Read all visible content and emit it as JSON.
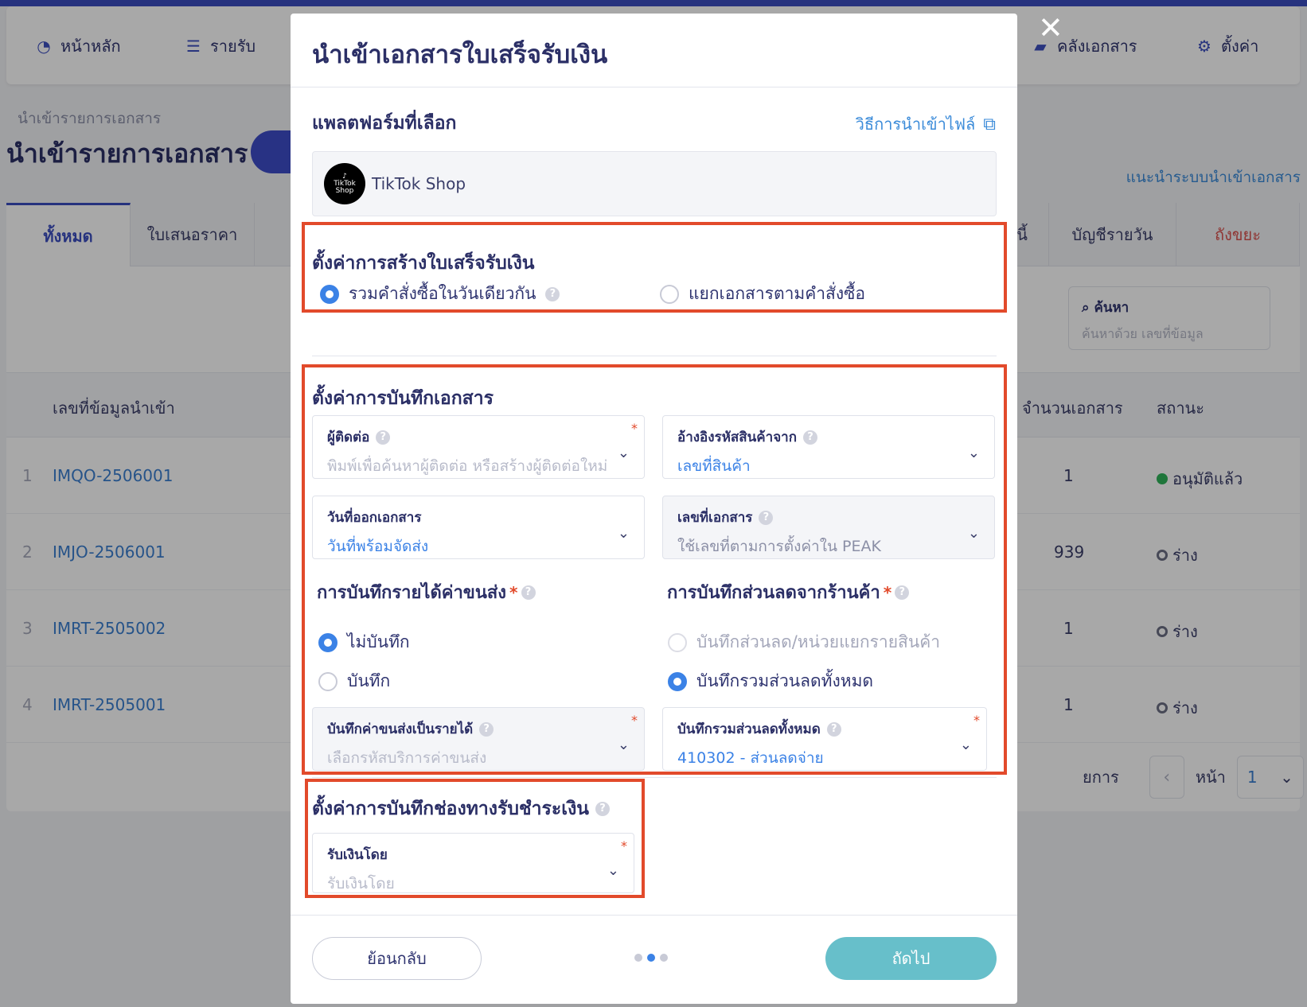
{
  "nav": {
    "items": [
      {
        "icon": "dashboard-icon",
        "label": "หน้าหลัก"
      },
      {
        "icon": "coins-icon",
        "label": "รายรับ"
      },
      {
        "icon": "folder-icon",
        "label": "คลังเอกสาร"
      },
      {
        "icon": "gear-icon",
        "label": "ตั้งค่า"
      }
    ]
  },
  "page": {
    "breadcrumb": "นำเข้ารายการเอกสาร",
    "title": "นำเข้ารายการเอกสาร",
    "guide_link": "แนะนำระบบนำเข้าเอกสาร",
    "tabs": [
      "ทั้งหมด",
      "ใบเสนอราคา",
      "หนี้",
      "บัญชีรายวัน",
      "ถังขยะ"
    ],
    "search": {
      "label": "ค้นหา",
      "placeholder": "ค้นหาด้วย เลขที่ข้อมูล"
    },
    "table": {
      "headers": [
        "เลขที่ข้อมูลนำเข้า",
        "จำนวนเอกสาร",
        "สถานะ"
      ],
      "rows": [
        {
          "index": "1",
          "id": "IMQO-2506001",
          "count": "1",
          "status": "อนุมัติแล้ว"
        },
        {
          "index": "2",
          "id": "IMJO-2506001",
          "count": "939",
          "status": "ร่าง"
        },
        {
          "index": "3",
          "id": "IMRT-2505002",
          "count": "1",
          "status": "ร่าง"
        },
        {
          "index": "4",
          "id": "IMRT-2505001",
          "count": "1",
          "status": "ร่าง"
        }
      ]
    },
    "pager": {
      "items_suffix": "ยการ",
      "page_label": "หน้า",
      "page_value": "1"
    }
  },
  "modal": {
    "title": "นำเข้าเอกสารใบเสร็จรับเงิน",
    "platform_title": "แพลตฟอร์มที่เลือก",
    "howto_link": "วิธีการนำเข้าไฟล์",
    "platform_name": "TikTok Shop",
    "platform_logo_text": "TikTok Shop",
    "creation": {
      "title": "ตั้งค่าการสร้างใบเสร็จรับเงิน",
      "option_merge": "รวมคำสั่งซื้อในวันเดียวกัน",
      "option_split": "แยกเอกสารตามคำสั่งซื้อ"
    },
    "save": {
      "title": "ตั้งค่าการบันทึกเอกสาร",
      "contact": {
        "label": "ผู้ติดต่อ",
        "placeholder": "พิมพ์เพื่อค้นหาผู้ติดต่อ หรือสร้างผู้ติดต่อใหม่"
      },
      "product_ref": {
        "label": "อ้างอิงรหัสสินค้าจาก",
        "value": "เลขที่สินค้า"
      },
      "issue_date": {
        "label": "วันที่ออกเอกสาร",
        "value": "วันที่พร้อมจัดส่ง"
      },
      "doc_number": {
        "label": "เลขที่เอกสาร",
        "value": "ใช้เลขที่ตามการตั้งค่าใน PEAK"
      },
      "shipping": {
        "title": "การบันทึกรายได้ค่าขนส่ง",
        "option_no": "ไม่บันทึก",
        "option_yes": "บันทึก",
        "field_label": "บันทึกค่าขนส่งเป็นรายได้",
        "field_placeholder": "เลือกรหัสบริการค่าขนส่ง"
      },
      "discount": {
        "title": "การบันทึกส่วนลดจากร้านค้า",
        "option_per_item": "บันทึกส่วนลด/หน่วยแยกรายสินค้า",
        "option_total": "บันทึกรวมส่วนลดทั้งหมด",
        "field_label": "บันทึกรวมส่วนลดทั้งหมด",
        "field_value": "410302 - ส่วนลดจ่าย"
      }
    },
    "payment": {
      "title": "ตั้งค่าการบันทึกช่องทางรับชำระเงิน",
      "field_label": "รับเงินโดย",
      "field_placeholder": "รับเงินโดย"
    },
    "footer": {
      "back": "ย้อนกลับ",
      "next": "ถัดไป"
    }
  },
  "colors": {
    "primary": "#3b4cc0",
    "accent": "#3b82e6",
    "highlight_box": "#e24a2b",
    "next_button": "#67bfca"
  }
}
